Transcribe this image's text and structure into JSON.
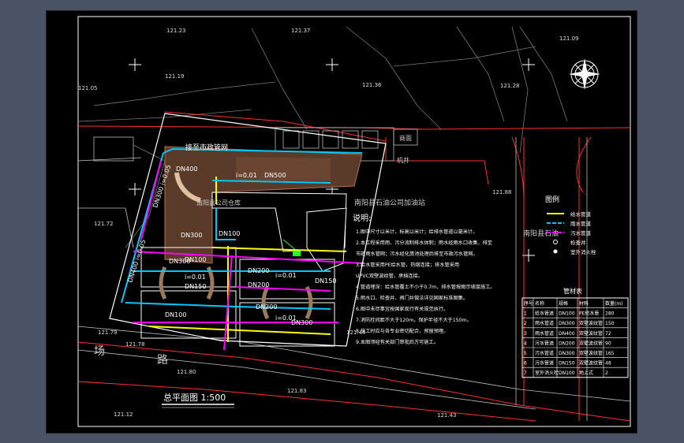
{
  "drawing": {
    "title": "总平面图 1:500",
    "elevations": [
      "121.23",
      "121.37",
      "121.09",
      "121.19",
      "121.05",
      "121.36",
      "121.28",
      "121.72",
      "121.44",
      "121.78",
      "121.80",
      "121.83",
      "121.12",
      "121.43",
      "121.88",
      "121.79"
    ],
    "road_labels": [
      "场",
      "路"
    ],
    "sewer_label": "接至市政管网",
    "gas_station": "南阳县石油公司加油站",
    "gas_station_short": "南阳县石油",
    "warehouse": "南阳县公司仓库",
    "machine_well": "机井",
    "building_tag": "商面",
    "pipe_labels": [
      "DN400",
      "DN100",
      "DN300",
      "DN500",
      "DN300",
      "DN100",
      "DN200",
      "DN150",
      "DN200",
      "DN150",
      "DN200",
      "DN100",
      "DN300"
    ],
    "slope_labels": [
      "i=0.01",
      "i=0.01",
      "i=0.01",
      "i=0.01"
    ],
    "side_labels": [
      "DN300 i=0.05",
      "DN400 i=0.05"
    ]
  },
  "notes": {
    "heading": "说明:",
    "lines": [
      "1.图中尺寸以米计，标高以米计；给排水管道以毫米计。",
      "2.本工程采用雨、污分流制排水体制；雨水经雨水口收集，排至",
      "  市政雨水管网；污水经化粪池处理后排至市政污水管网。",
      "3.给水管采用PE给水管，热熔连接；排水管采用",
      "  UPVC双壁波纹管，承插连接。",
      "4.管道埋深：给水管覆土不小于0.7m，排水管按图示坡度施工。",
      "5.雨水口、检查井、阀门井做法详见国家标准图集。",
      "6.图中未尽事宜按国家现行有关规范执行。",
      "7.消防栓间距不大于120m，保护半径不大于150m。",
      "8.施工时应与各专业密切配合，预留预埋。",
      "9.本图须经有关部门审批后方可施工。"
    ]
  },
  "legend": {
    "title": "图例",
    "items": [
      {
        "label": "给水管道",
        "color": "#ffff00"
      },
      {
        "label": "雨水管道",
        "color": "#00c8ff"
      },
      {
        "label": "污水管道",
        "color": "#ff00ff"
      },
      {
        "label": "检查井",
        "color": "#ffffff"
      },
      {
        "label": "室外消火栓",
        "color": "#ffffff"
      }
    ]
  },
  "material_table": {
    "title": "管材表",
    "headers": [
      "序号",
      "名称",
      "规格",
      "材料",
      "数量(m)"
    ],
    "rows": [
      [
        "1",
        "给水管道",
        "DN100",
        "PE给水管",
        "280"
      ],
      [
        "2",
        "雨水管道",
        "DN300",
        "双壁波纹管",
        "150"
      ],
      [
        "3",
        "雨水管道",
        "DN400",
        "双壁波纹管",
        "72"
      ],
      [
        "4",
        "污水管道",
        "DN200",
        "双壁波纹管",
        "90"
      ],
      [
        "5",
        "污水管道",
        "DN300",
        "双壁波纹管",
        "165"
      ],
      [
        "6",
        "污水管道",
        "DN150",
        "双壁波纹管",
        "48"
      ],
      [
        "7",
        "室外消火栓",
        "DN100",
        "地上式",
        "2"
      ]
    ]
  }
}
